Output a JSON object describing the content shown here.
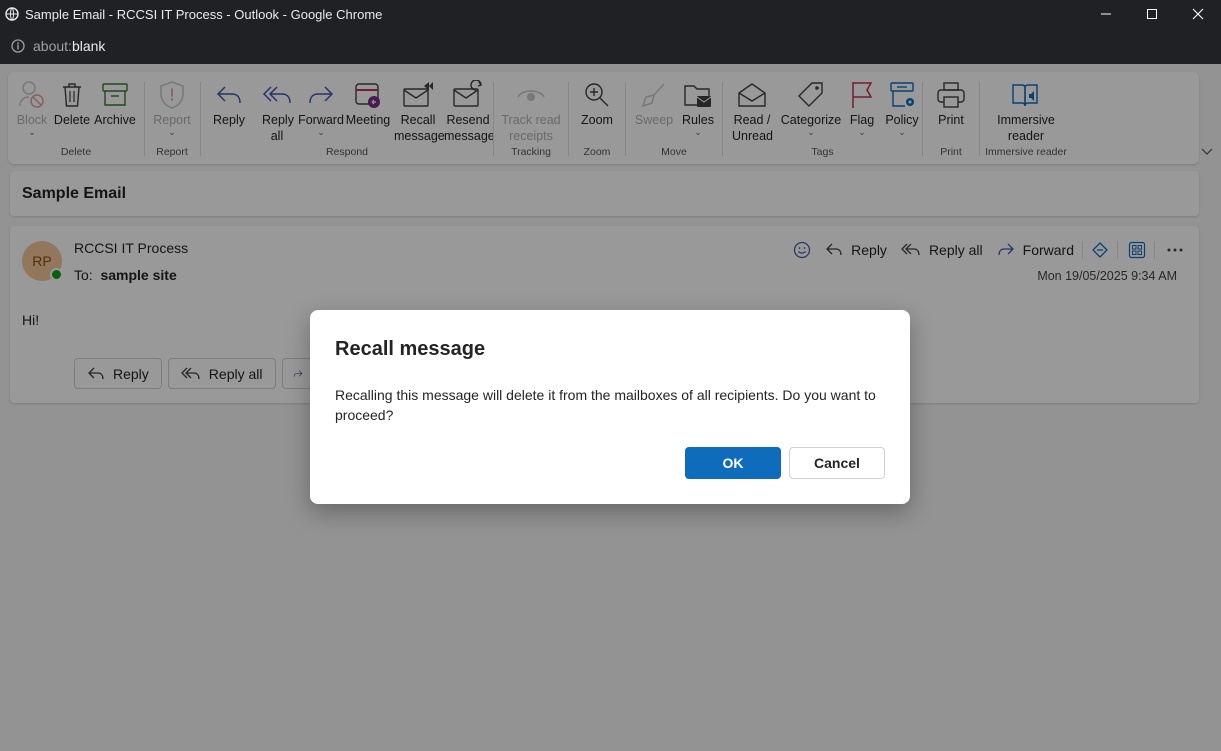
{
  "window": {
    "title": "Sample Email - RCCSI IT Process - Outlook - Google Chrome",
    "url_scheme": "about:",
    "url_path": "blank"
  },
  "ribbon": {
    "groups": [
      {
        "name": "Delete",
        "buttons": [
          {
            "label": "Block",
            "disabled": true,
            "icon": "block-icon"
          },
          {
            "label": "Delete",
            "icon": "trash-icon"
          },
          {
            "label": "Archive",
            "icon": "archive-icon"
          }
        ]
      },
      {
        "name": "Report",
        "buttons": [
          {
            "label": "Report",
            "disabled": true,
            "icon": "shield-icon"
          }
        ]
      },
      {
        "name": "Respond",
        "buttons": [
          {
            "label": "Reply",
            "icon": "reply-icon"
          },
          {
            "label": "Reply all",
            "icon": "reply-all-icon"
          },
          {
            "label": "Forward",
            "icon": "forward-icon"
          },
          {
            "label": "Meeting",
            "icon": "meeting-icon"
          },
          {
            "label": "Recall message",
            "icon": "recall-icon"
          },
          {
            "label": "Resend message",
            "icon": "resend-icon"
          }
        ]
      },
      {
        "name": "Tracking",
        "buttons": [
          {
            "label": "Track read receipts",
            "disabled": true,
            "icon": "eye-icon"
          }
        ]
      },
      {
        "name": "Zoom",
        "buttons": [
          {
            "label": "Zoom",
            "icon": "zoom-icon"
          }
        ]
      },
      {
        "name": "Move",
        "buttons": [
          {
            "label": "Sweep",
            "disabled": true,
            "icon": "broom-icon"
          },
          {
            "label": "Rules",
            "icon": "rules-icon"
          }
        ]
      },
      {
        "name": "Tags",
        "buttons": [
          {
            "label": "Read / Unread",
            "icon": "envelope-open-icon"
          },
          {
            "label": "Categorize",
            "icon": "tag-icon"
          },
          {
            "label": "Flag",
            "icon": "flag-icon"
          },
          {
            "label": "Policy",
            "icon": "policy-icon"
          }
        ]
      },
      {
        "name": "Print",
        "buttons": [
          {
            "label": "Print",
            "icon": "printer-icon"
          }
        ]
      },
      {
        "name": "Immersive reader",
        "buttons": [
          {
            "label": "Immersive reader",
            "icon": "immersive-reader-icon"
          }
        ]
      }
    ]
  },
  "email": {
    "subject": "Sample Email",
    "sender_initials": "RP",
    "sender": "RCCSI IT Process",
    "to_label": "To:",
    "to": "sample site",
    "date": "Mon 19/05/2025 9:34 AM",
    "body": "Hi!",
    "actions": {
      "reply": "Reply",
      "reply_all": "Reply all",
      "forward": "Forward"
    },
    "bottom_actions": {
      "reply": "Reply",
      "reply_all": "Reply all"
    }
  },
  "dialog": {
    "title": "Recall message",
    "message": "Recalling this message will delete it from the mailboxes of all recipients. Do you want to proceed?",
    "ok": "OK",
    "cancel": "Cancel"
  },
  "colors": {
    "accent": "#0f6cbd",
    "avatar_bg": "#f2c79a",
    "presence": "#13a10e"
  }
}
